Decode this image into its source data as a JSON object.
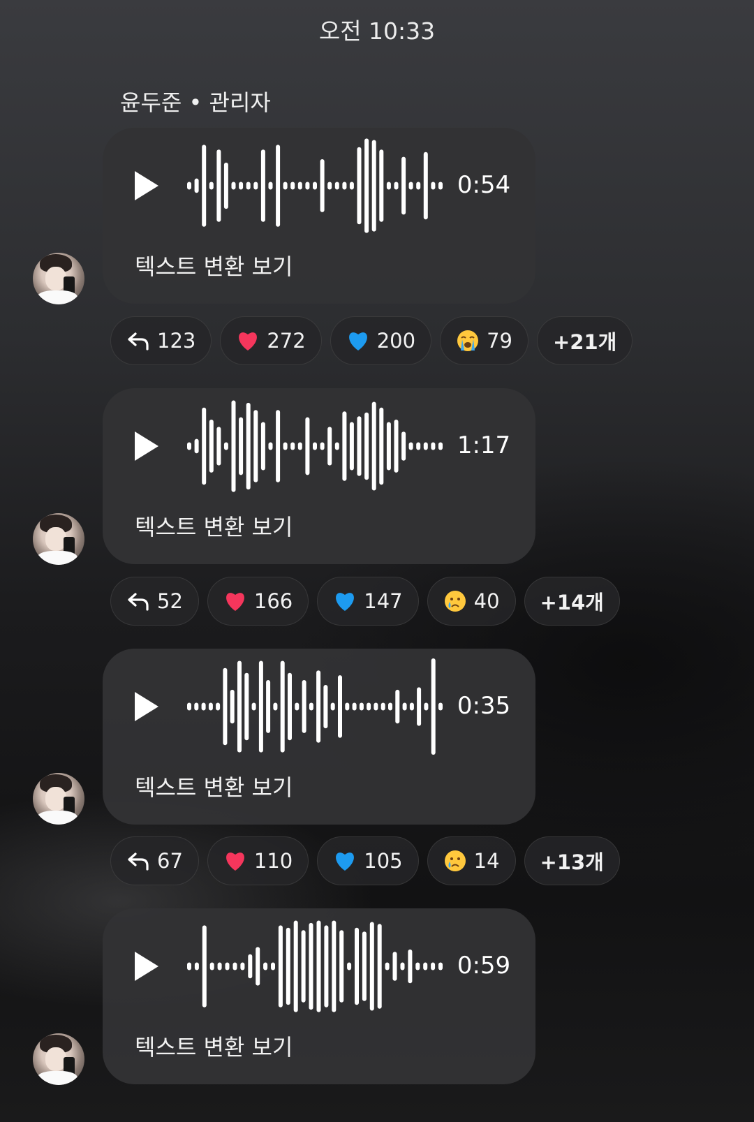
{
  "timestamp": "오전 10:33",
  "sender": "윤두준 • 관리자",
  "messages": [
    {
      "duration": "0:54",
      "transcribe_label": "텍스트 변환 보기",
      "waveform": [
        0.08,
        0.15,
        0.85,
        0.08,
        0.75,
        0.48,
        0.08,
        0.08,
        0.08,
        0.08,
        0.75,
        0.08,
        0.85,
        0.08,
        0.08,
        0.08,
        0.08,
        0.08,
        0.55,
        0.08,
        0.08,
        0.08,
        0.08,
        0.8,
        0.98,
        0.95,
        0.75,
        0.08,
        0.08,
        0.6,
        0.08,
        0.08,
        0.7,
        0.08,
        0.08
      ],
      "reactions": [
        {
          "icon": "reply-icon",
          "count": "123"
        },
        {
          "icon": "red-heart-icon",
          "count": "272"
        },
        {
          "icon": "blue-heart-icon",
          "count": "200"
        },
        {
          "icon": "loudly-crying-face-icon",
          "count": "79"
        }
      ],
      "more_label": "+21개"
    },
    {
      "duration": "1:17",
      "transcribe_label": "텍스트 변환 보기",
      "waveform": [
        0.08,
        0.15,
        0.8,
        0.55,
        0.4,
        0.08,
        0.95,
        0.6,
        0.9,
        0.75,
        0.5,
        0.08,
        0.75,
        0.08,
        0.08,
        0.08,
        0.6,
        0.08,
        0.08,
        0.4,
        0.08,
        0.72,
        0.5,
        0.62,
        0.7,
        0.92,
        0.8,
        0.5,
        0.55,
        0.3,
        0.08,
        0.08,
        0.08,
        0.08,
        0.08
      ],
      "reactions": [
        {
          "icon": "reply-icon",
          "count": "52"
        },
        {
          "icon": "red-heart-icon",
          "count": "166"
        },
        {
          "icon": "blue-heart-icon",
          "count": "147"
        },
        {
          "icon": "crying-face-icon",
          "count": "40"
        }
      ],
      "more_label": "+14개"
    },
    {
      "duration": "0:35",
      "transcribe_label": "텍스트 변환 보기",
      "waveform": [
        0.08,
        0.08,
        0.08,
        0.08,
        0.08,
        0.8,
        0.35,
        0.95,
        0.7,
        0.08,
        0.95,
        0.55,
        0.08,
        0.95,
        0.7,
        0.08,
        0.55,
        0.08,
        0.75,
        0.45,
        0.08,
        0.65,
        0.08,
        0.08,
        0.08,
        0.08,
        0.08,
        0.08,
        0.08,
        0.35,
        0.08,
        0.08,
        0.4,
        0.08,
        1.0,
        0.08
      ],
      "reactions": [
        {
          "icon": "reply-icon",
          "count": "67"
        },
        {
          "icon": "red-heart-icon",
          "count": "110"
        },
        {
          "icon": "blue-heart-icon",
          "count": "105"
        },
        {
          "icon": "crying-face-icon",
          "count": "14"
        }
      ],
      "more_label": "+13개"
    },
    {
      "duration": "0:59",
      "transcribe_label": "텍스트 변환 보기",
      "waveform": [
        0.08,
        0.08,
        0.85,
        0.08,
        0.08,
        0.08,
        0.08,
        0.08,
        0.25,
        0.4,
        0.08,
        0.08,
        0.85,
        0.8,
        0.95,
        0.75,
        0.9,
        0.95,
        0.85,
        0.95,
        0.75,
        0.08,
        0.8,
        0.72,
        0.92,
        0.88,
        0.08,
        0.3,
        0.08,
        0.35,
        0.08,
        0.08,
        0.08,
        0.08
      ],
      "reactions": [],
      "more_label": ""
    }
  ]
}
